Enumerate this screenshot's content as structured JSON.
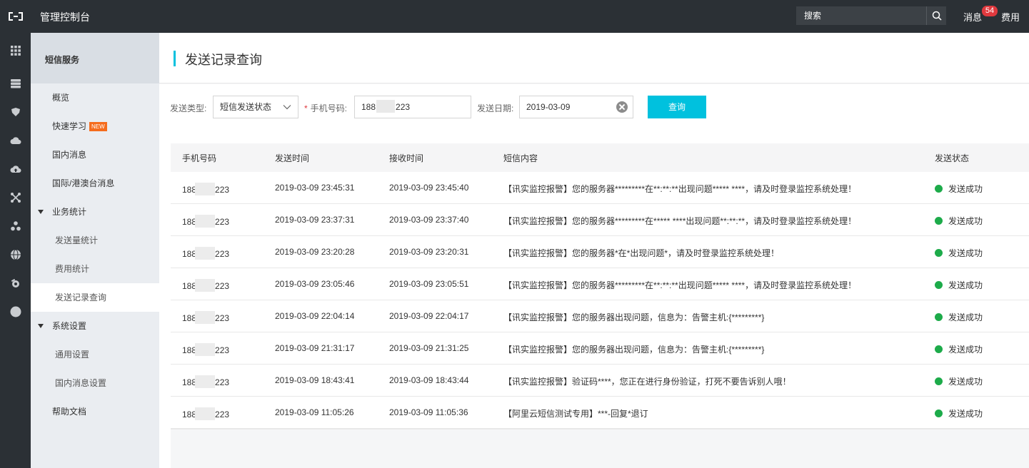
{
  "header": {
    "title": "管理控制台",
    "search_placeholder": "搜索",
    "messages_label": "消息",
    "messages_count": "54",
    "fee_label": "费用"
  },
  "rail_icons": [
    "apps-grid-icon",
    "server-icon",
    "database-icon",
    "cloud-icon",
    "cloud-upload-icon",
    "network-icon",
    "cluster-icon",
    "globe-icon",
    "settings-gear-icon",
    "circle-icon"
  ],
  "sidebar": {
    "service_title": "短信服务",
    "items": [
      {
        "label": "概览",
        "level": 1
      },
      {
        "label": "快速学习",
        "level": 1,
        "badge": "NEW"
      },
      {
        "label": "国内消息",
        "level": 1
      },
      {
        "label": "国际/港澳台消息",
        "level": 1
      },
      {
        "label": "业务统计",
        "level": "group"
      },
      {
        "label": "发送量统计",
        "level": 2
      },
      {
        "label": "费用统计",
        "level": 2
      },
      {
        "label": "发送记录查询",
        "level": 2,
        "active": true
      },
      {
        "label": "系统设置",
        "level": "group"
      },
      {
        "label": "通用设置",
        "level": 2
      },
      {
        "label": "国内消息设置",
        "level": 2
      },
      {
        "label": "帮助文档",
        "level": 1
      }
    ]
  },
  "page": {
    "title": "发送记录查询"
  },
  "filters": {
    "type_label": "发送类型:",
    "type_value": "短信发送状态",
    "phone_label": "手机号码:",
    "phone_prefix": "188",
    "phone_suffix": "223",
    "date_label": "发送日期:",
    "date_value": "2019-03-09",
    "query_label": "查询"
  },
  "table": {
    "columns": [
      "手机号码",
      "发送时间",
      "接收时间",
      "短信内容",
      "发送状态"
    ],
    "rows": [
      {
        "phone_prefix": "188",
        "phone_suffix": "223",
        "send_time": "2019-03-09 23:45:31",
        "recv_time": "2019-03-09 23:45:40",
        "content": "【讯实监控报警】您的服务器*********在**:**:**出现问题***** ****，请及时登录监控系统处理！",
        "status": "发送成功"
      },
      {
        "phone_prefix": "188",
        "phone_suffix": "223",
        "send_time": "2019-03-09 23:37:31",
        "recv_time": "2019-03-09 23:37:40",
        "content": "【讯实监控报警】您的服务器*********在***** ****出现问题**:**:**，请及时登录监控系统处理！",
        "status": "发送成功"
      },
      {
        "phone_prefix": "188",
        "phone_suffix": "223",
        "send_time": "2019-03-09 23:20:28",
        "recv_time": "2019-03-09 23:20:31",
        "content": "【讯实监控报警】您的服务器*在*出现问题*，请及时登录监控系统处理！",
        "status": "发送成功"
      },
      {
        "phone_prefix": "188",
        "phone_suffix": "223",
        "send_time": "2019-03-09 23:05:46",
        "recv_time": "2019-03-09 23:05:51",
        "content": "【讯实监控报警】您的服务器*********在**:**:**出现问题***** ****，请及时登录监控系统处理！",
        "status": "发送成功"
      },
      {
        "phone_prefix": "188",
        "phone_suffix": "223",
        "send_time": "2019-03-09 22:04:14",
        "recv_time": "2019-03-09 22:04:17",
        "content": "【讯实监控报警】您的服务器出现问题，信息为：告警主机:{*********}",
        "status": "发送成功"
      },
      {
        "phone_prefix": "188",
        "phone_suffix": "223",
        "send_time": "2019-03-09 21:31:17",
        "recv_time": "2019-03-09 21:31:25",
        "content": "【讯实监控报警】您的服务器出现问题，信息为：告警主机:{*********}",
        "status": "发送成功"
      },
      {
        "phone_prefix": "188",
        "phone_suffix": "223",
        "send_time": "2019-03-09 18:43:41",
        "recv_time": "2019-03-09 18:43:44",
        "content": "【讯实监控报警】验证码****，您正在进行身份验证，打死不要告诉别人哦！",
        "status": "发送成功"
      },
      {
        "phone_prefix": "188",
        "phone_suffix": "223",
        "send_time": "2019-03-09 11:05:26",
        "recv_time": "2019-03-09 11:05:36",
        "content": "【阿里云短信测试专用】***-回复*退订",
        "status": "发送成功"
      }
    ]
  },
  "colors": {
    "topbar": "#2b3035",
    "accent": "#00c1de",
    "success": "#1dab4a",
    "badge": "#e0393e"
  }
}
